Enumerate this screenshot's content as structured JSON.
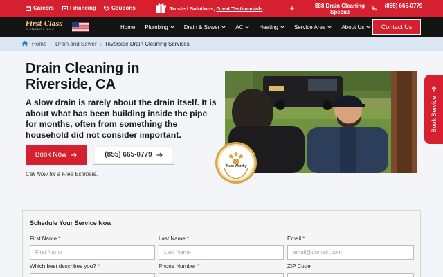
{
  "topbar": {
    "careers": "Careers",
    "financing": "Financing",
    "coupons": "Coupons",
    "trusted_prefix": "Trusted Solutions,",
    "trusted_link": "Great Testimonials",
    "trusted_suffix": ".",
    "special": "$88 Drain Cleaning Special",
    "phone": "(855) 665-0779"
  },
  "nav": {
    "logo_name": "First Class",
    "logo_sub": "PLUMBING & HVAC",
    "items": [
      {
        "label": "Home"
      },
      {
        "label": "Plumbing"
      },
      {
        "label": "Drain & Sewer"
      },
      {
        "label": "AC"
      },
      {
        "label": "Heating"
      },
      {
        "label": "Service Area"
      },
      {
        "label": "About Us"
      }
    ],
    "contact": "Contact Us"
  },
  "breadcrumb": {
    "home": "Home",
    "parent": "Drain and Sewer",
    "current": "Riverside Drain Cleaning Services"
  },
  "hero": {
    "title": "Drain Cleaning in Riverside, CA",
    "body": "A slow drain is rarely about the drain itself. It is about what has been building inside the pipe for months, often from something the household did not consider important.",
    "book": "Book Now",
    "phone": "(855) 665-0779",
    "note": "Call Now for a Free Estimate."
  },
  "badge": {
    "text": "Trust Worthy"
  },
  "sidetab": {
    "label": "Book Service"
  },
  "form": {
    "title": "Schedule Your Service Now",
    "first_name_label": "First Name",
    "first_name_placeholder": "First Name",
    "last_name_label": "Last Name",
    "last_name_placeholder": "Last Name",
    "email_label": "Email",
    "email_placeholder": "email@domain.com",
    "describe_label": "Which best describes you?",
    "phone_label": "Phone Number",
    "zip_label": "ZIP Code",
    "required_mark": "*"
  },
  "colors": {
    "brand_red": "#d6202f",
    "nav_black": "#141414",
    "breadcrumb_bg": "#dbe7f3"
  }
}
